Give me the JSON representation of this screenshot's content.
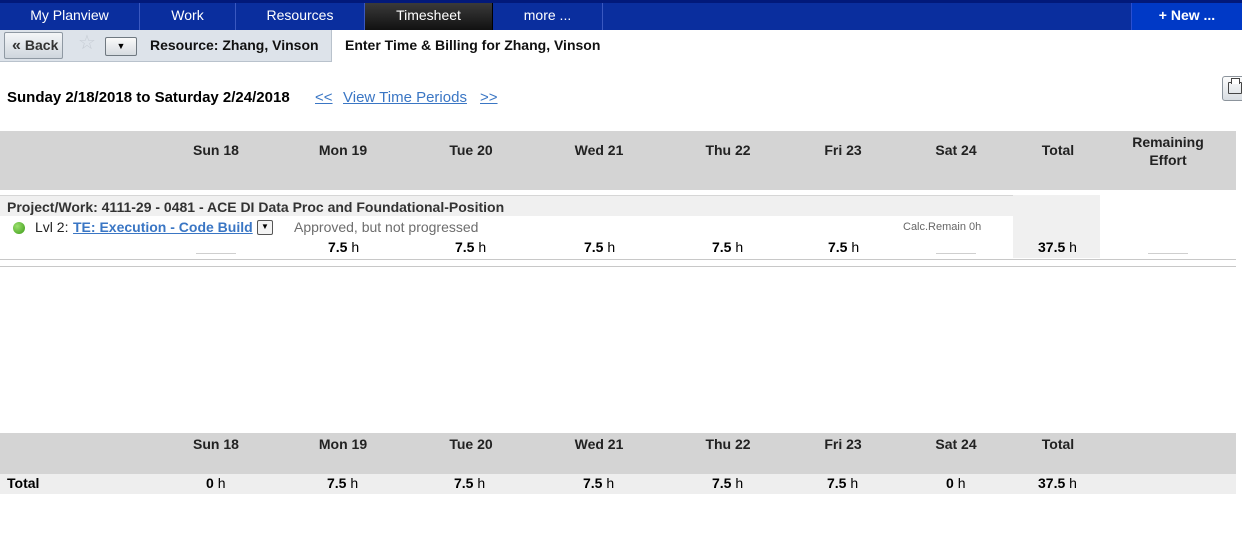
{
  "nav": {
    "tabs": [
      "My Planview",
      "Work",
      "Resources",
      "Timesheet",
      "more ..."
    ],
    "active": "Timesheet",
    "new_label": "+ New ..."
  },
  "toolbar": {
    "back_label": "Back",
    "resource_label": "Resource:  Zhang, Vinson",
    "page_title": "Enter Time & Billing for Zhang, Vinson"
  },
  "period": {
    "label": "Sunday 2/18/2018 to Saturday 2/24/2018",
    "prev": "<<",
    "view_link": "View Time Periods",
    "next": ">>"
  },
  "columns": [
    "Sun 18",
    "Mon 19",
    "Tue 20",
    "Wed 21",
    "Thu 22",
    "Fri 23",
    "Sat 24",
    "Total"
  ],
  "remaining_header": "Remaining Effort",
  "project": {
    "title": "Project/Work: 4111-29 - 0481 - ACE DI Data Proc and Foundational-Position",
    "level_label": "Lvl 2:",
    "task_link": "TE: Execution - Code Build",
    "status": "Approved, but not progressed",
    "calc_remain": "Calc.Remain 0h",
    "hours": [
      "",
      "7.5",
      "7.5",
      "7.5",
      "7.5",
      "7.5",
      "",
      "37.5"
    ],
    "unit": "h"
  },
  "totals": {
    "label": "Total",
    "hours": [
      "0",
      "7.5",
      "7.5",
      "7.5",
      "7.5",
      "7.5",
      "0",
      "37.5"
    ],
    "unit": "h"
  },
  "colors": {
    "nav_bg": "#0a2e9e",
    "link": "#3a76c4",
    "status_dot": "#3a9a16",
    "header_band": "#d4d4d4"
  }
}
